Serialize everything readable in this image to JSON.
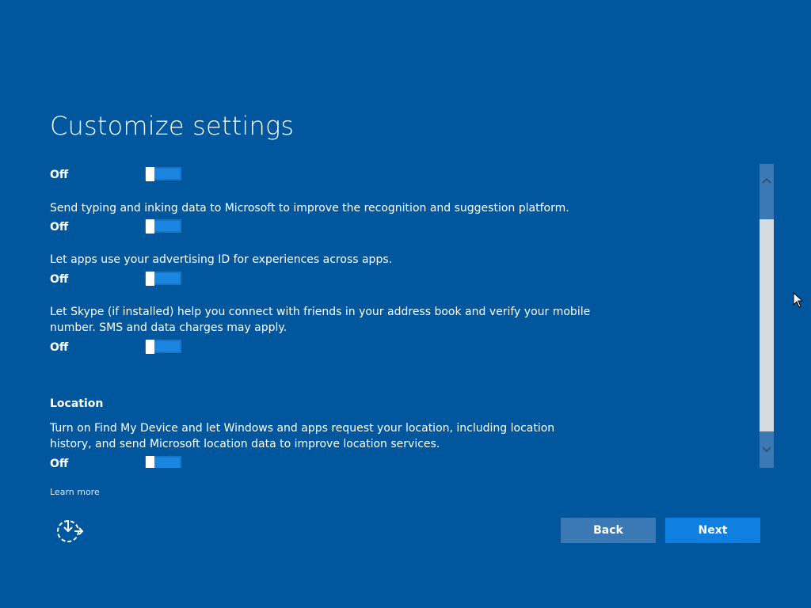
{
  "title": "Customize settings",
  "settings": [
    {
      "description": "",
      "state": "Off"
    },
    {
      "description": "Send typing and inking data to Microsoft to improve the recognition and suggestion platform.",
      "state": "Off"
    },
    {
      "description": "Let apps use your advertising ID for experiences across apps.",
      "state": "Off"
    },
    {
      "description": "Let Skype (if installed) help you connect with friends in your address book and verify your mobile number. SMS and data charges may apply.",
      "state": "Off"
    }
  ],
  "location": {
    "heading": "Location",
    "description": "Turn on Find My Device and let Windows and apps request your location, including location history, and send Microsoft location data to improve location services.",
    "state": "Off"
  },
  "learn_more": "Learn more",
  "buttons": {
    "back": "Back",
    "next": "Next"
  },
  "icons": {
    "ease_of_access": "ease-of-access-icon",
    "scroll_up": "chevron-up-icon",
    "scroll_down": "chevron-down-icon",
    "cursor": "mouse-pointer-icon"
  },
  "colors": {
    "background": "#00579e",
    "toggle_fill": "#1a86e2",
    "next_button": "#0f7fe0",
    "back_button": "#3b79b4"
  }
}
